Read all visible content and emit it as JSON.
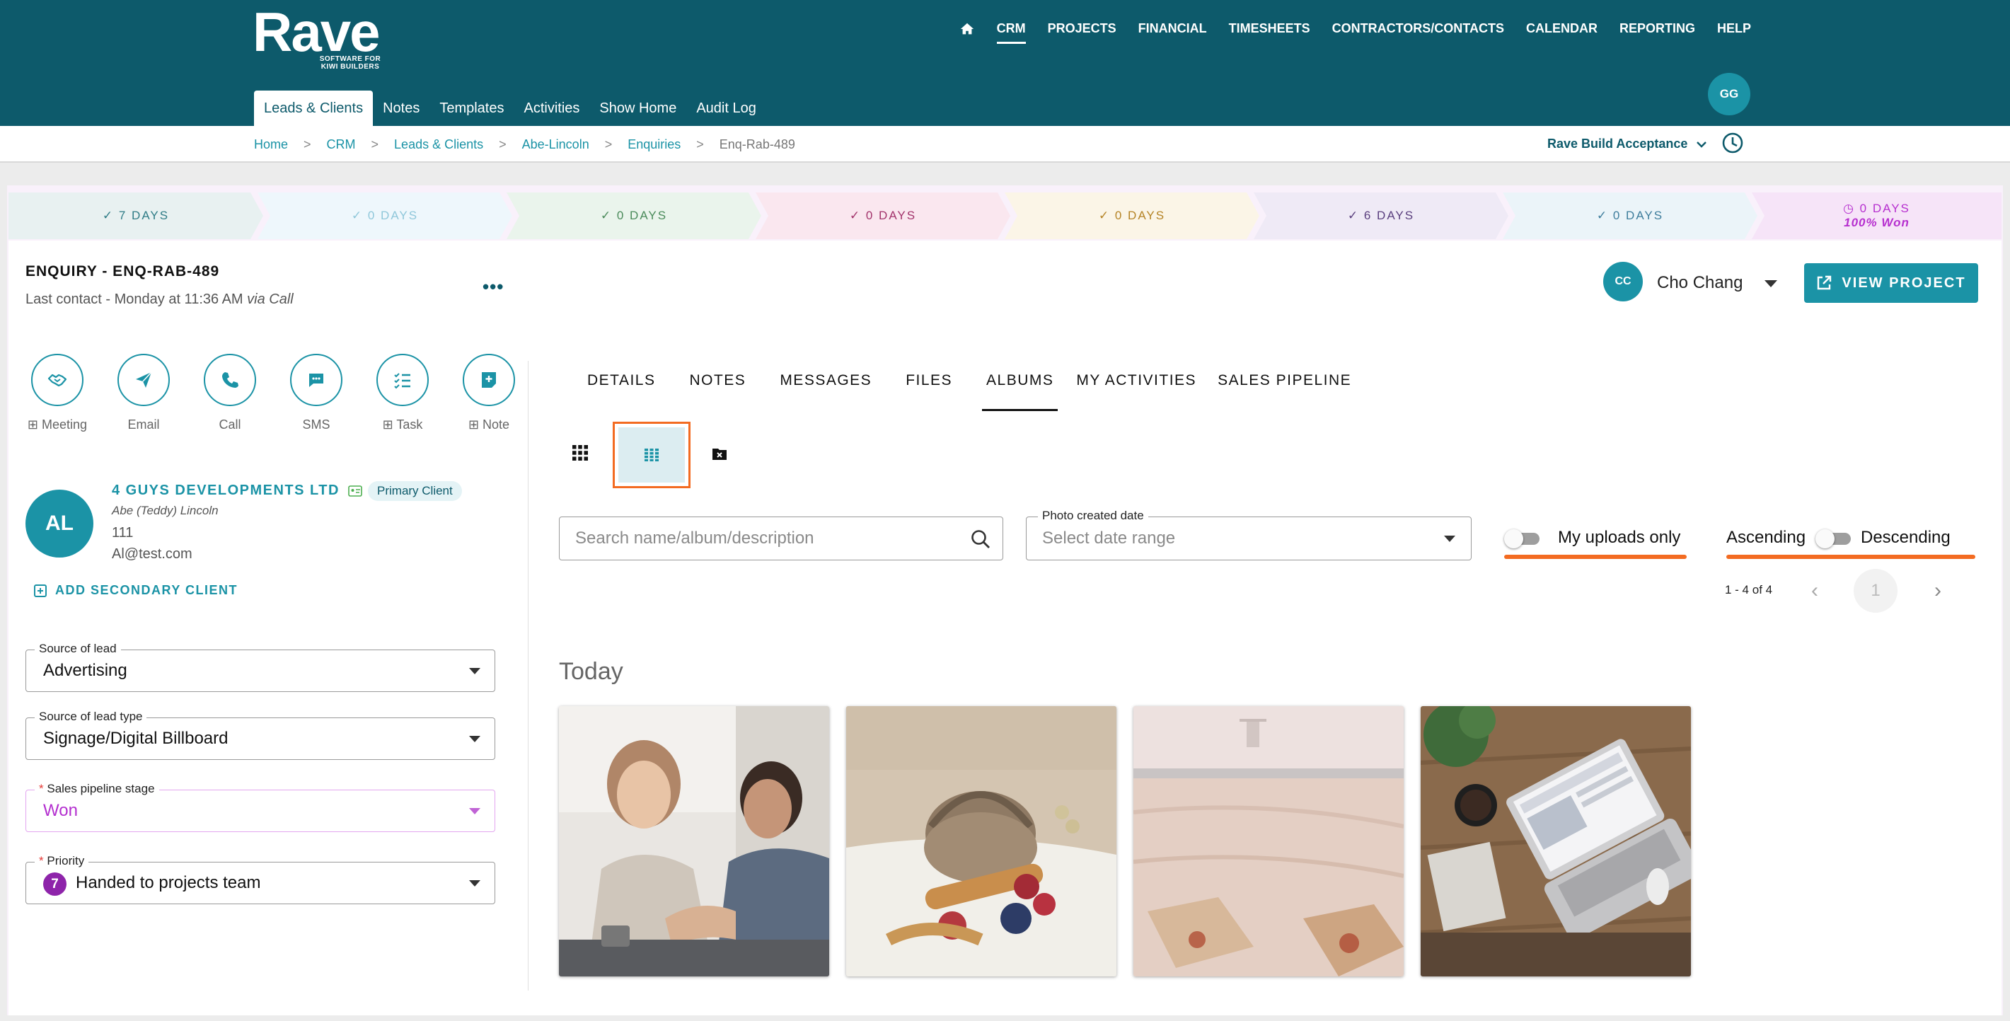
{
  "brand": {
    "name": "Rave",
    "tagline_line1": "SOFTWARE FOR",
    "tagline_line2": "KIWI BUILDERS"
  },
  "main_nav": {
    "items": [
      {
        "label": "CRM",
        "active": true
      },
      {
        "label": "PROJECTS"
      },
      {
        "label": "FINANCIAL"
      },
      {
        "label": "TIMESHEETS"
      },
      {
        "label": "CONTRACTORS/CONTACTS"
      },
      {
        "label": "CALENDAR"
      },
      {
        "label": "REPORTING"
      },
      {
        "label": "HELP"
      }
    ]
  },
  "user": {
    "initials": "GG"
  },
  "sub_nav": {
    "items": [
      {
        "label": "Leads & Clients",
        "active": true
      },
      {
        "label": "Notes"
      },
      {
        "label": "Templates"
      },
      {
        "label": "Activities"
      },
      {
        "label": "Show Home"
      },
      {
        "label": "Audit Log"
      }
    ]
  },
  "breadcrumb": [
    "Home",
    "CRM",
    "Leads & Clients",
    "Abe-Lincoln",
    "Enquiries",
    "Enq-Rab-489"
  ],
  "breadcrumb_sep": ">",
  "org_selector": "Rave Build Acceptance",
  "stages": [
    {
      "label": "7 DAYS",
      "bg": "#e8f1f1",
      "color": "#2f7c86"
    },
    {
      "label": "0 DAYS",
      "bg": "#eef7fc",
      "color": "#8fc7da"
    },
    {
      "label": "0 DAYS",
      "bg": "#eaf4ec",
      "color": "#4a8a5a"
    },
    {
      "label": "0 DAYS",
      "bg": "#fae7ef",
      "color": "#a2336b"
    },
    {
      "label": "0 DAYS",
      "bg": "#fbf5e7",
      "color": "#b58426"
    },
    {
      "label": "6 DAYS",
      "bg": "#efeaf6",
      "color": "#5a3f7e"
    },
    {
      "label": "0 DAYS",
      "bg": "#ebf4f9",
      "color": "#3e7d9c"
    },
    {
      "label": "0 DAYS",
      "bg": "#f6e4f8",
      "color": "#b62fcf",
      "sub": "100% Won"
    }
  ],
  "enquiry": {
    "title": "ENQUIRY - ENQ-RAB-489",
    "last_contact": "Last contact - Monday at 11:36 AM",
    "last_contact_via": "via Call"
  },
  "quick_actions": [
    {
      "label": "Meeting",
      "icon": "handshake-icon",
      "plus": true
    },
    {
      "label": "Email",
      "icon": "send-icon",
      "plus": false
    },
    {
      "label": "Call",
      "icon": "phone-icon",
      "plus": false
    },
    {
      "label": "SMS",
      "icon": "sms-icon",
      "plus": false
    },
    {
      "label": "Task",
      "icon": "checklist-icon",
      "plus": true
    },
    {
      "label": "Note",
      "icon": "note-add-icon",
      "plus": true
    }
  ],
  "client": {
    "initials": "AL",
    "company": "4 GUYS DEVELOPMENTS LTD",
    "badge": "Primary Client",
    "contact": "Abe (Teddy) Lincoln",
    "number": "111",
    "email": "Al@test.com",
    "add_secondary": "ADD SECONDARY CLIENT"
  },
  "fields": {
    "source_of_lead": {
      "label": "Source of lead",
      "value": "Advertising"
    },
    "source_type": {
      "label": "Source of lead type",
      "value": "Signage/Digital Billboard"
    },
    "pipeline_stage": {
      "label": "Sales pipeline stage",
      "value": "Won",
      "required": "*"
    },
    "priority": {
      "label": "Priority",
      "value": "Handed to projects team",
      "badge": "7",
      "required": "*"
    }
  },
  "owner": {
    "initials": "CC",
    "name": "Cho Chang"
  },
  "view_project": "VIEW PROJECT",
  "tabs": [
    {
      "label": "DETAILS"
    },
    {
      "label": "NOTES"
    },
    {
      "label": "MESSAGES"
    },
    {
      "label": "FILES"
    },
    {
      "label": "ALBUMS",
      "active": true
    },
    {
      "label": "MY ACTIVITIES"
    },
    {
      "label": "SALES PIPELINE"
    }
  ],
  "albums": {
    "search_placeholder": "Search name/album/description",
    "date_label": "Photo created date",
    "date_placeholder": "Select date range",
    "my_uploads": "My uploads only",
    "sort_asc": "Ascending",
    "sort_desc": "Descending",
    "pager_range": "1 - 4 of 4",
    "page": "1",
    "section": "Today"
  },
  "colors": {
    "brand": "#0d5a6b",
    "accent": "#1b93a6",
    "highlight": "#f36b21",
    "won": "#b62fcf"
  }
}
